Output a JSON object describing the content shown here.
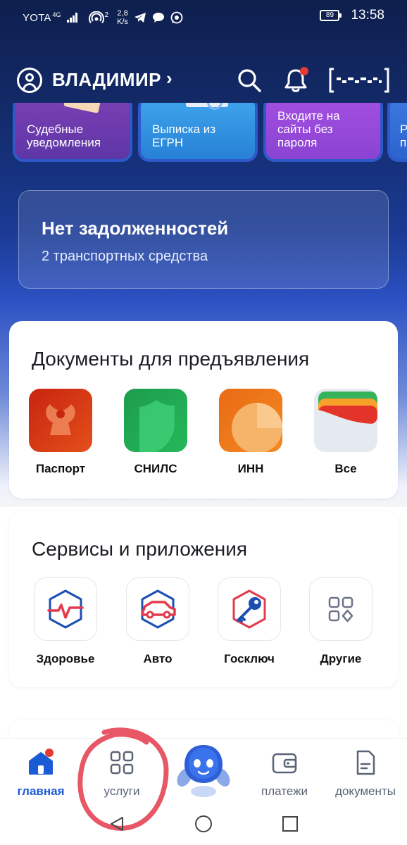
{
  "status_bar": {
    "carrier": "YOTA",
    "network": "4G",
    "hotspot_badge": "2",
    "speed_value": "2,8",
    "speed_unit": "K/s",
    "battery": "89",
    "time": "13:58"
  },
  "header": {
    "user_name": "ВЛАДИМИР",
    "chevron": "›"
  },
  "stories": [
    {
      "label": "Судебные уведомления"
    },
    {
      "label": "Выписка из ЕГРН"
    },
    {
      "label": "Входите на сайты без пароля"
    },
    {
      "label": "Р п"
    }
  ],
  "debt_card": {
    "title": "Нет задолженностей",
    "subtitle": "2 транспортных средства"
  },
  "documents": {
    "title": "Документы для предъявления",
    "items": [
      {
        "label": "Паспорт",
        "icon": "passport-icon"
      },
      {
        "label": "СНИЛС",
        "icon": "snils-shield-icon"
      },
      {
        "label": "ИНН",
        "icon": "inn-pie-icon"
      },
      {
        "label": "Все",
        "icon": "wallet-icon"
      }
    ]
  },
  "services": {
    "title": "Сервисы и приложения",
    "items": [
      {
        "label": "Здоровье",
        "icon": "health-icon"
      },
      {
        "label": "Авто",
        "icon": "car-icon"
      },
      {
        "label": "Госключ",
        "icon": "key-icon"
      },
      {
        "label": "Другие",
        "icon": "grid-icon"
      }
    ]
  },
  "bottom_nav": {
    "items": [
      {
        "label": "главная",
        "icon": "home-icon",
        "active": true
      },
      {
        "label": "услуги",
        "icon": "services-grid-icon",
        "active": false
      },
      {
        "label": "",
        "icon": "assistant-robot-icon",
        "active": false
      },
      {
        "label": "платежи",
        "icon": "wallet-icon",
        "active": false
      },
      {
        "label": "документы",
        "icon": "document-icon",
        "active": false
      }
    ]
  },
  "colors": {
    "accent": "#1c5bd6",
    "notification": "#e53935",
    "annotation": "#e33a4a"
  }
}
